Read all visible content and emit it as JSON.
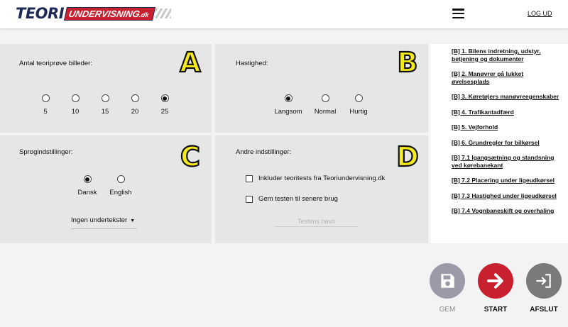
{
  "header": {
    "logo_teori": "TEORI",
    "logo_undervisning": "UNDERVISNING",
    "logo_dk": ".dk",
    "logout_label": "LOG UD"
  },
  "panels": {
    "a": {
      "letter": "A",
      "title": "Antal teoriprøve billeder:",
      "options": [
        "5",
        "10",
        "15",
        "20",
        "25"
      ],
      "selected": "25"
    },
    "b": {
      "letter": "B",
      "title": "Hastighed:",
      "options": [
        "Langsom",
        "Normal",
        "Hurtig"
      ],
      "selected": "Langsom"
    },
    "c": {
      "letter": "C",
      "title": "Sprogindstillinger:",
      "options": [
        "Dansk",
        "English"
      ],
      "selected": "Dansk",
      "subtitle_select": "Ingen undertekster"
    },
    "d": {
      "letter": "D",
      "title": "Andre indstillinger:",
      "checkbox_1": "Inkluder teoritests fra Teoriundervisning.dk",
      "checkbox_2": "Gem testen til senere brug",
      "name_placeholder": "Testens navn"
    }
  },
  "topics": [
    "[B] 1. Bilens indretning, udstyr, betjening og dokumenter",
    "[B] 2. Manøvrer på lukket øvelsesplads",
    "[B] 3. Køretøjers manøvreegenskaber",
    "[B] 4. Trafikantadfærd",
    "[B] 5. Vejforhold",
    "[B] 6. Grundregler for bilkørsel",
    "[B] 7.1 Igangsætning og standsning ved kørebanekant",
    "[B] 7.2 Placering under ligeudkørsel",
    "[B] 7.3 Hastighed under ligeudkørsel",
    "[B] 7.4 Vognbaneskift og overhaling"
  ],
  "actions": {
    "save_label": "GEM",
    "start_label": "START",
    "exit_label": "AFSLUT",
    "save_color": "#9a9aa8",
    "start_color": "#c8202f",
    "exit_color": "#7a7a7a"
  }
}
